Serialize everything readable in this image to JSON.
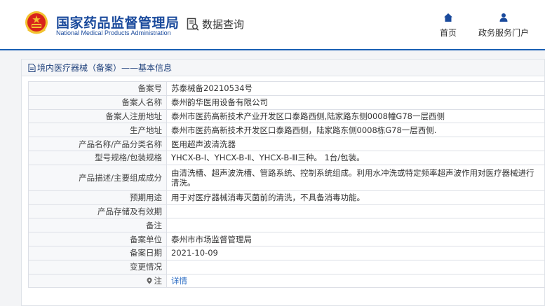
{
  "header": {
    "org_name_cn": "国家药品监督管理局",
    "org_name_en": "National Medical Products Administration",
    "data_query_label": "数据查询",
    "nav": {
      "home_label": "首页",
      "portal_label": "政务服务门户"
    },
    "icons": {
      "emblem": "national-emblem-icon",
      "query": "document-search-icon",
      "home": "home-icon",
      "portal": "user-icon"
    }
  },
  "panel": {
    "title": "境内医疗器械（备案）——基本信息",
    "rows": [
      {
        "label": "备案号",
        "value": "苏泰械备20210534号"
      },
      {
        "label": "备案人名称",
        "value": "泰州韵华医用设备有限公司"
      },
      {
        "label": "备案人注册地址",
        "value": "泰州市医药高新技术产业开发区口泰路西侧,陆家路东侧0008幢G78一层西侧"
      },
      {
        "label": "生产地址",
        "value": "泰州市医药高新技术开发区口泰路西侧，陆家路东侧0008栋G78一层西侧."
      },
      {
        "label": "产品名称/产品分类名称",
        "value": "医用超声波清洗器"
      },
      {
        "label": "型号规格/包装规格",
        "value": "YHCX-B-Ⅰ、YHCX-B-Ⅱ、YHCX-B-Ⅲ三种。 1台/包装。"
      },
      {
        "label": "产品描述/主要组成成分",
        "value": "由清洗槽、超声波洗槽、管路系统、控制系统组成。利用水冲洗或特定频率超声波作用对医疗器械进行清洗。"
      },
      {
        "label": "预期用途",
        "value": "用于对医疗器械消毒灭菌前的清洗，不具备消毒功能。"
      },
      {
        "label": "产品存储及有效期",
        "value": ""
      },
      {
        "label": "备注",
        "value": ""
      },
      {
        "label": "备案单位",
        "value": "泰州市市场监督管理局"
      },
      {
        "label": "备案日期",
        "value": "2021-10-09"
      },
      {
        "label": "变更情况",
        "value": ""
      },
      {
        "label": "注",
        "value": "详情"
      }
    ]
  },
  "colors": {
    "brand_blue": "#1a4a9c",
    "header_line": "#1a5fb4",
    "link": "#2b6cc4",
    "emblem_red": "#d8231c",
    "emblem_gold": "#f2c230"
  }
}
